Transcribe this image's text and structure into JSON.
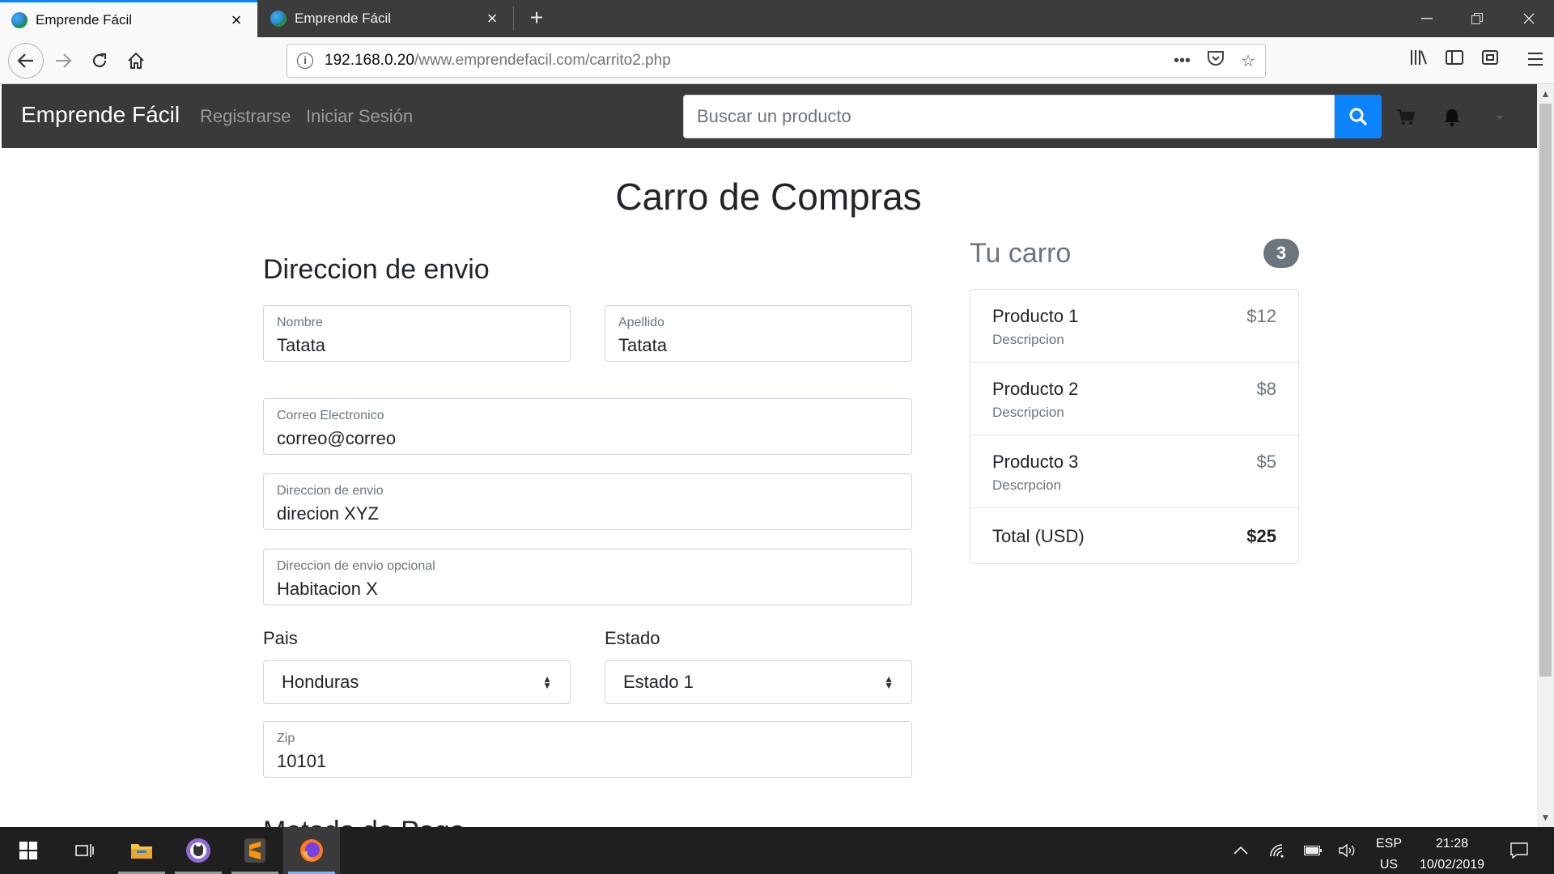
{
  "browser": {
    "tabs": [
      {
        "title": "Emprende Fácil",
        "active": true
      },
      {
        "title": "Emprende Fácil",
        "active": false
      }
    ],
    "url_host": "192.168.0.20",
    "url_path": "/www.emprendefacil.com/carrito2.php",
    "accent_color": "#0a84ff"
  },
  "site_nav": {
    "brand": "Emprende Fácil",
    "links": [
      "Registrarse",
      "Iniciar Sesión"
    ],
    "search_placeholder": "Buscar un producto",
    "search_button_color": "#0d84ff",
    "icons": [
      "search-icon",
      "cart-icon",
      "bell-icon",
      "dropdown-caret-icon"
    ]
  },
  "page": {
    "title": "Carro de Compras",
    "shipping_section_title": "Direccion de envio",
    "next_section_title": "Metodo de Pago"
  },
  "form": {
    "nombre": {
      "label": "Nombre",
      "value": "Tatata"
    },
    "apellido": {
      "label": "Apellido",
      "value": "Tatata"
    },
    "correo": {
      "label": "Correo Electronico",
      "value": "correo@correo"
    },
    "direccion": {
      "label": "Direccion de envio",
      "value": "direcion XYZ"
    },
    "direccion_opcional": {
      "label": "Direccion de envio opcional",
      "value": "Habitacion X"
    },
    "pais": {
      "label": "Pais",
      "value": "Honduras"
    },
    "estado": {
      "label": "Estado",
      "value": "Estado 1"
    },
    "zip": {
      "label": "Zip",
      "value": "10101"
    }
  },
  "cart": {
    "title": "Tu carro",
    "count": "3",
    "items": [
      {
        "name": "Producto 1",
        "description": "Descripcion",
        "price": "$12"
      },
      {
        "name": "Producto 2",
        "description": "Descripcion",
        "price": "$8"
      },
      {
        "name": "Producto 3",
        "description": "Descrpcion",
        "price": "$5"
      }
    ],
    "total_label": "Total (USD)",
    "total_value": "$25"
  },
  "taskbar": {
    "language": "ESP",
    "layout": "US",
    "time": "21:28",
    "date": "10/02/2019",
    "apps": [
      "windows-start-icon",
      "task-view-icon",
      "file-explorer-icon",
      "github-desktop-icon",
      "sublime-text-icon",
      "firefox-icon"
    ]
  }
}
